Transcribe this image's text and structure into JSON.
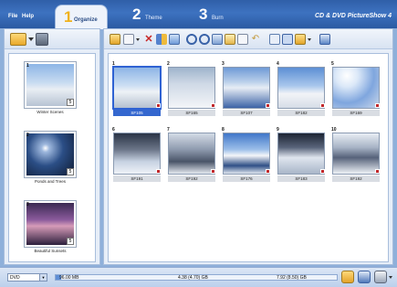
{
  "menu": {
    "file": "File",
    "help": "Help"
  },
  "steps": [
    {
      "num": "1",
      "label": "Organize"
    },
    {
      "num": "2",
      "label": "Theme"
    },
    {
      "num": "3",
      "label": "Burn"
    }
  ],
  "app_title": "CD & DVD PictureShow 4",
  "left_items": [
    {
      "idx": "1",
      "label": "Winter Scenes",
      "count": "5"
    },
    {
      "idx": "2",
      "label": "Ponds and Trees",
      "count": "5"
    },
    {
      "idx": "3",
      "label": "Beautiful Sunsets",
      "count": "5"
    }
  ],
  "photos": [
    {
      "idx": "1",
      "name": "SF105"
    },
    {
      "idx": "2",
      "name": "SF165"
    },
    {
      "idx": "3",
      "name": "SF107"
    },
    {
      "idx": "4",
      "name": "SF182"
    },
    {
      "idx": "5",
      "name": "SF169"
    },
    {
      "idx": "6",
      "name": "SF191"
    },
    {
      "idx": "7",
      "name": "SF192"
    },
    {
      "idx": "8",
      "name": "SF176"
    },
    {
      "idx": "9",
      "name": "SF183"
    },
    {
      "idx": "10",
      "name": "SF192"
    }
  ],
  "status": {
    "disc_type": "DVD",
    "size_used": "96.00 MB",
    "cap_mid": "4.38 (4.70) GB",
    "cap_right": "7.92 (8.50) GB",
    "fill_fraction": 0.02
  }
}
